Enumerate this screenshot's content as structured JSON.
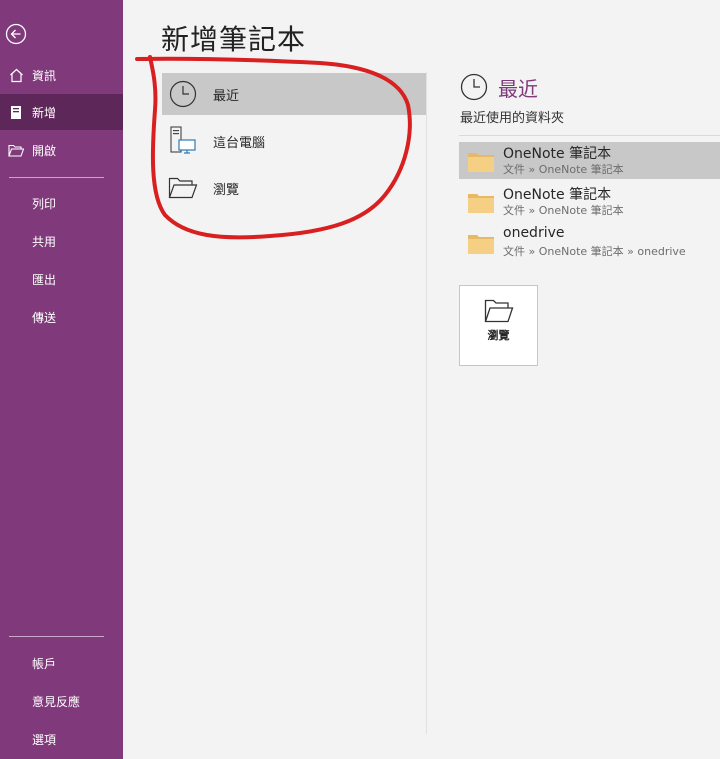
{
  "sidebar": {
    "items": [
      {
        "label": "資訊"
      },
      {
        "label": "新增"
      },
      {
        "label": "開啟"
      },
      {
        "label": "列印"
      },
      {
        "label": "共用"
      },
      {
        "label": "匯出"
      },
      {
        "label": "傳送"
      }
    ],
    "bottom_items": [
      {
        "label": "帳戶"
      },
      {
        "label": "意見反應"
      },
      {
        "label": "選項"
      }
    ]
  },
  "page": {
    "title": "新增筆記本"
  },
  "locations": [
    {
      "label": "最近"
    },
    {
      "label": "這台電腦"
    },
    {
      "label": "瀏覽"
    }
  ],
  "recent": {
    "title": "最近",
    "subtitle": "最近使用的資料夾",
    "folders": [
      {
        "name": "OneNote 筆記本",
        "path": "文件 » OneNote 筆記本"
      },
      {
        "name": "OneNote 筆記本",
        "path": "文件 » OneNote 筆記本"
      },
      {
        "name": "onedrive",
        "path": "文件 » OneNote 筆記本 » onedrive"
      }
    ],
    "browse_label": "瀏覽"
  },
  "colors": {
    "accent": "#80397b",
    "accent_active": "#5e2759",
    "annotation": "#d92020"
  }
}
